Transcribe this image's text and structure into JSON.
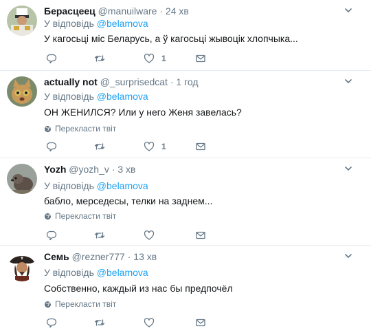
{
  "tweets": [
    {
      "name": "Берасцеец",
      "handle": "@manuilware",
      "dot": "·",
      "time": "24 хв",
      "reply_prefix": "У відповідь",
      "reply_to": "@belamova",
      "text": "У кагосьці міс Беларусь, а ў кагосьці жывоцік хлопчыка...",
      "translate": "",
      "likes": "1"
    },
    {
      "name": "actually not",
      "handle": "@_surprisedcat",
      "dot": "·",
      "time": "1 год",
      "reply_prefix": "У відповідь",
      "reply_to": "@belamova",
      "text": "ОН ЖЕНИЛСЯ? Или у него Женя завелась?",
      "translate": "Перекласти твіт",
      "likes": "1"
    },
    {
      "name": "Yozh",
      "handle": "@yozh_v",
      "dot": "·",
      "time": "3 хв",
      "reply_prefix": "У відповідь",
      "reply_to": "@belamova",
      "text": "бабло, мерседесы, телки на заднем...",
      "translate": "Перекласти твіт",
      "likes": ""
    },
    {
      "name": "Семь",
      "handle": "@rezner777",
      "dot": "·",
      "time": "13 хв",
      "reply_prefix": "У відповідь",
      "reply_to": "@belamova",
      "text": "Собственно, каждый из нас бы предпочёл",
      "translate": "Перекласти твіт",
      "likes": ""
    }
  ],
  "colors": {
    "link": "#1da1f2",
    "muted": "#657786",
    "text": "#14171a",
    "border": "#e6ecf0"
  },
  "icons": {
    "reply": "reply-icon",
    "retweet": "retweet-icon",
    "like": "heart-icon",
    "message": "envelope-icon",
    "more": "chevron-down-icon",
    "translate": "globe-icon"
  }
}
